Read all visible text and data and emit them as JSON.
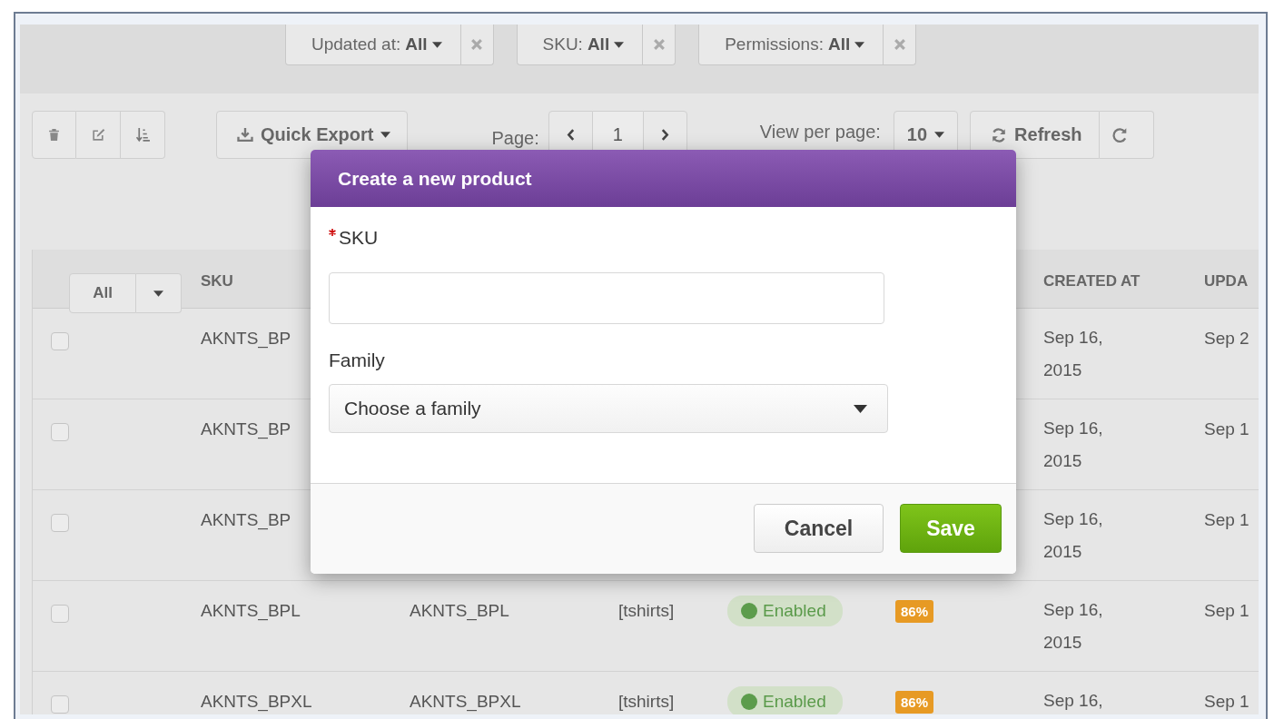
{
  "filters": [
    {
      "label": "Updated at:",
      "value": "All"
    },
    {
      "label": "SKU:",
      "value": "All"
    },
    {
      "label": "Permissions:",
      "value": "All"
    }
  ],
  "toolbar": {
    "quick_export": "Quick Export",
    "page_label": "Page:",
    "page": "1",
    "per_page_label": "View per page:",
    "per_page": "10",
    "refresh": "Refresh"
  },
  "table": {
    "select_all": "All",
    "columns": [
      "SKU",
      "CREATED AT",
      "UPDA"
    ],
    "rows": [
      {
        "checked": false,
        "sku": "AKNTS_BP",
        "created_at": "Sep 16, 2015",
        "updated_at": "Sep 2"
      },
      {
        "checked": false,
        "sku": "AKNTS_BP",
        "created_at": "Sep 16, 2015",
        "updated_at": "Sep 1"
      },
      {
        "checked": false,
        "sku": "AKNTS_BP",
        "created_at": "Sep 16, 2015",
        "updated_at": "Sep 1"
      },
      {
        "checked": false,
        "sku": "AKNTS_BPL",
        "column_3": "AKNTS_BPL",
        "column_4": "[tshirts]",
        "status": "Enabled",
        "complete": "86%",
        "created_at": "Sep 16, 2015",
        "updated_at": "Sep 1"
      },
      {
        "checked": false,
        "sku": "AKNTS_BPXL",
        "column_3": "AKNTS_BPXL",
        "column_4": "[tshirts]",
        "status": "Enabled",
        "complete": "86%",
        "created_at": "Sep 16,",
        "updated_at": "Sep 1"
      }
    ]
  },
  "modal": {
    "title": "Create a new product",
    "fields": [
      {
        "kind": "text",
        "label": "SKU",
        "required": true
      },
      {
        "kind": "select",
        "label": "Family",
        "required": false,
        "placeholder": "Choose a family"
      }
    ],
    "buttons": [
      {
        "label": "Cancel",
        "kind": "secondary"
      },
      {
        "label": "Save",
        "kind": "primary"
      }
    ]
  }
}
